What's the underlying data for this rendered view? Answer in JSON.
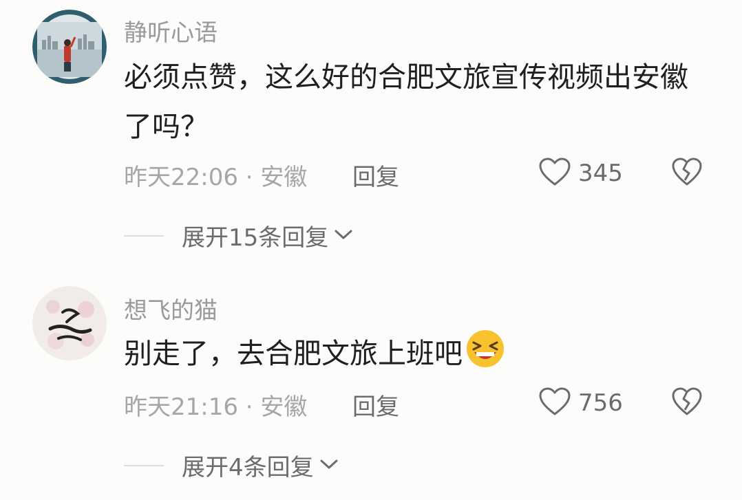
{
  "comments": [
    {
      "username": "静听心语",
      "text": "必须点赞，这么好的合肥文旅宣传视频出安徽了吗？",
      "time_location": "昨天22:06 · 安徽",
      "reply_label": "回复",
      "likes": "345",
      "expand_label": "展开15条回复"
    },
    {
      "username": "想飞的猫",
      "text": "别走了，去合肥文旅上班吧",
      "emoji": "laughing-emoji",
      "time_location": "昨天21:16 · 安徽",
      "reply_label": "回复",
      "likes": "756",
      "expand_label": "展开4条回复"
    }
  ],
  "icons": {
    "like": "heart-outline-icon",
    "dislike": "broken-heart-icon",
    "expand": "chevron-down-icon"
  },
  "colors": {
    "background": "#fcfcfa",
    "username": "#9a9a9a",
    "text": "#1f1f1f",
    "meta": "#a6a6a6",
    "action": "#6b6b6b",
    "emoji": "#f7c22e"
  }
}
